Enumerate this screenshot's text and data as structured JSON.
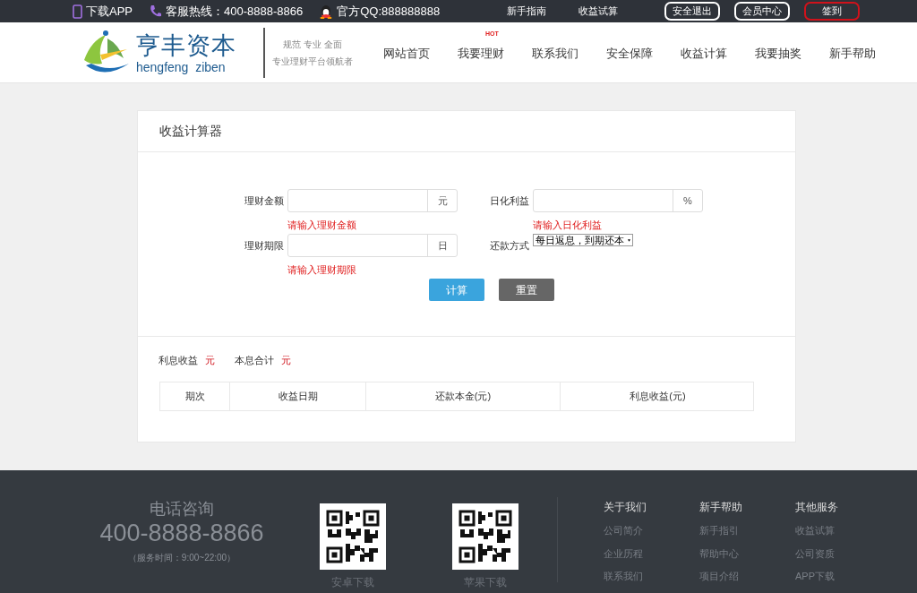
{
  "top_bar": {
    "contacts": [
      {
        "text": "下载APP"
      },
      {
        "text": "客服热线：400-8888-8866"
      },
      {
        "text": "官方QQ:888888888"
      }
    ],
    "links": [
      "新手指南",
      "收益试算"
    ],
    "buttons": [
      {
        "label": "安全退出",
        "highlighted": false
      },
      {
        "label": "会员中心",
        "highlighted": false
      },
      {
        "label": "签到",
        "highlighted": true
      }
    ]
  },
  "header": {
    "logo": {
      "name": "亨丰资本",
      "pinyin": "hengfeng  ziben"
    },
    "slogan": [
      "规范 专业 全面",
      "专业理财平台领航者"
    ],
    "nav": [
      {
        "label": "网站首页"
      },
      {
        "label": "我要理财",
        "badge": "HOT"
      },
      {
        "label": "联系我们"
      },
      {
        "label": "安全保障"
      },
      {
        "label": "收益计算"
      },
      {
        "label": "我要抽奖"
      },
      {
        "label": "新手帮助"
      }
    ]
  },
  "calculator": {
    "title": "收益计算器",
    "fields": [
      {
        "kind": "input",
        "label": "理财金额",
        "unit": "元",
        "error": "请输入理财金额"
      },
      {
        "kind": "input",
        "label": "日化利益",
        "unit": "%",
        "error": "请输入日化利益"
      },
      {
        "kind": "input",
        "label": "理财期限",
        "unit": "日",
        "error": "请输入理财期限"
      },
      {
        "kind": "select",
        "label": "还款方式",
        "value": "每日返息，到期还本"
      }
    ],
    "buttons": [
      {
        "label": "计算",
        "kind": "primary"
      },
      {
        "label": "重置",
        "kind": "secondary"
      }
    ],
    "results": [
      {
        "label": "利息收益",
        "value": "元"
      },
      {
        "label": "本息合计",
        "value": "元"
      }
    ],
    "table": {
      "columns": [
        "期次",
        "收益日期",
        "还款本金(元)",
        "利息收益(元)"
      ]
    }
  },
  "footer": {
    "phone_title": "电话咨询",
    "phone": "400-8888-8866",
    "hours": "（服务时间：9:00~22:00）",
    "qr_codes": [
      {
        "caption": "安卓下载"
      },
      {
        "caption": "苹果下载"
      }
    ],
    "columns": [
      {
        "title": "关于我们",
        "links": [
          "公司简介",
          "企业历程",
          "联系我们"
        ]
      },
      {
        "title": "新手帮助",
        "links": [
          "新手指引",
          "帮助中心",
          "项目介绍"
        ]
      },
      {
        "title": "其他服务",
        "links": [
          "收益试算",
          "公司资质",
          "APP下载"
        ]
      }
    ]
  }
}
